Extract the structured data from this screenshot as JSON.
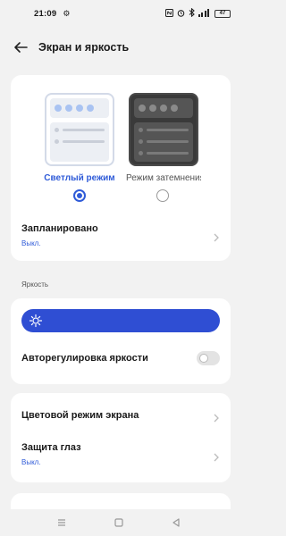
{
  "status_bar": {
    "time": "21:09",
    "battery": "47",
    "icons": [
      "gear-icon",
      "nfc-icon",
      "alarm-icon",
      "bluetooth-icon",
      "signal-icon",
      "battery-icon"
    ]
  },
  "header": {
    "title": "Экран и яркость"
  },
  "theme": {
    "light_label": "Светлый режим",
    "dark_label": "Режим затемнения",
    "selected": "light"
  },
  "schedule": {
    "title": "Запланировано",
    "value": "Выкл."
  },
  "brightness": {
    "section_label": "Яркость",
    "auto_label": "Авторегулировка яркости",
    "auto_enabled": false
  },
  "screen": {
    "color_mode_title": "Цветовой режим экрана",
    "eye_protection_title": "Защита глаз",
    "eye_protection_value": "Выкл."
  },
  "colors": {
    "accent": "#2f5bd8",
    "slider": "#2f4ed3"
  }
}
